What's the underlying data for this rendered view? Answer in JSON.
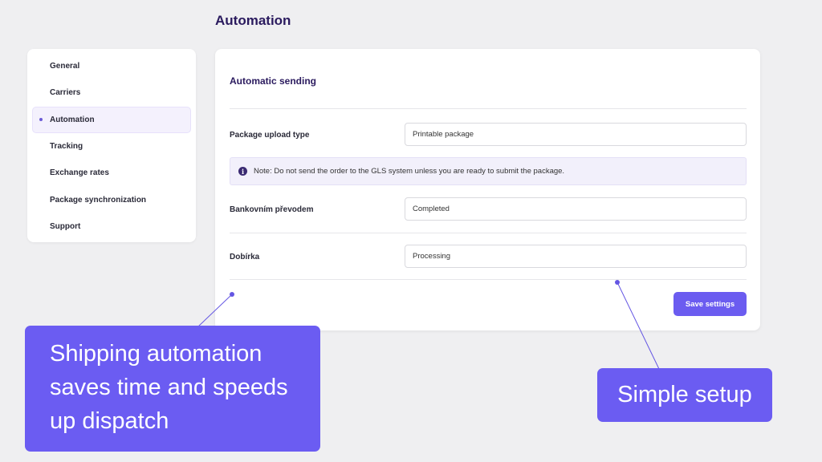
{
  "page": {
    "title": "Automation"
  },
  "sidebar": {
    "items": [
      {
        "label": "General",
        "active": false
      },
      {
        "label": "Carriers",
        "active": false
      },
      {
        "label": "Automation",
        "active": true
      },
      {
        "label": "Tracking",
        "active": false
      },
      {
        "label": "Exchange rates",
        "active": false
      },
      {
        "label": "Package synchronization",
        "active": false
      },
      {
        "label": "Support",
        "active": false
      }
    ]
  },
  "settings": {
    "section_title": "Automatic sending",
    "package_upload": {
      "label": "Package upload type",
      "value": "Printable package"
    },
    "note": {
      "icon": "info-icon",
      "text": "Note: Do not send the order to the GLS system unless you are ready to submit the package."
    },
    "bank_transfer": {
      "label": "Bankovním převodem",
      "value": "Completed"
    },
    "cash_on_delivery": {
      "label": "Dobírka",
      "value": "Processing"
    },
    "save_label": "Save settings"
  },
  "callouts": {
    "left": "Shipping automation saves time and speeds up dispatch",
    "right": "Simple setup"
  },
  "colors": {
    "accent": "#6b5cf0",
    "title": "#2a1a5e",
    "background": "#efeff1",
    "active_item_bg": "#f4f1fd"
  }
}
